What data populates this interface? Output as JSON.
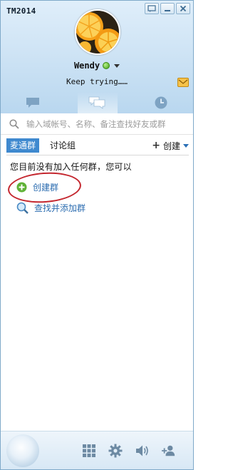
{
  "window": {
    "title": "TM2014"
  },
  "profile": {
    "nickname": "Wendy",
    "signature": "Keep trying……",
    "status": "online"
  },
  "search": {
    "placeholder": "输入域帐号、名称、备注查找好友或群"
  },
  "tabs": [
    {
      "icon": "chat-bubble-icon",
      "active": false
    },
    {
      "icon": "group-chat-icon",
      "active": true
    },
    {
      "icon": "clock-icon",
      "active": false
    }
  ],
  "groups": {
    "subtabs": [
      "麦通群",
      "讨论组"
    ],
    "active_subtab": "麦通群",
    "create_label": "创建",
    "empty_message": "您目前没有加入任何群，您可以",
    "actions": [
      {
        "label": "创建群",
        "icon": "add-circle-icon"
      },
      {
        "label": "查找并添加群",
        "icon": "magnifier-icon"
      }
    ]
  },
  "footer": {
    "icons": [
      "apps-grid-icon",
      "settings-gear-icon",
      "speaker-icon",
      "add-contact-icon"
    ]
  },
  "colors": {
    "accent": "#3f89cf",
    "link": "#2b6cb0",
    "highlight_ring": "#c4262e",
    "online": "#3e9e12"
  }
}
